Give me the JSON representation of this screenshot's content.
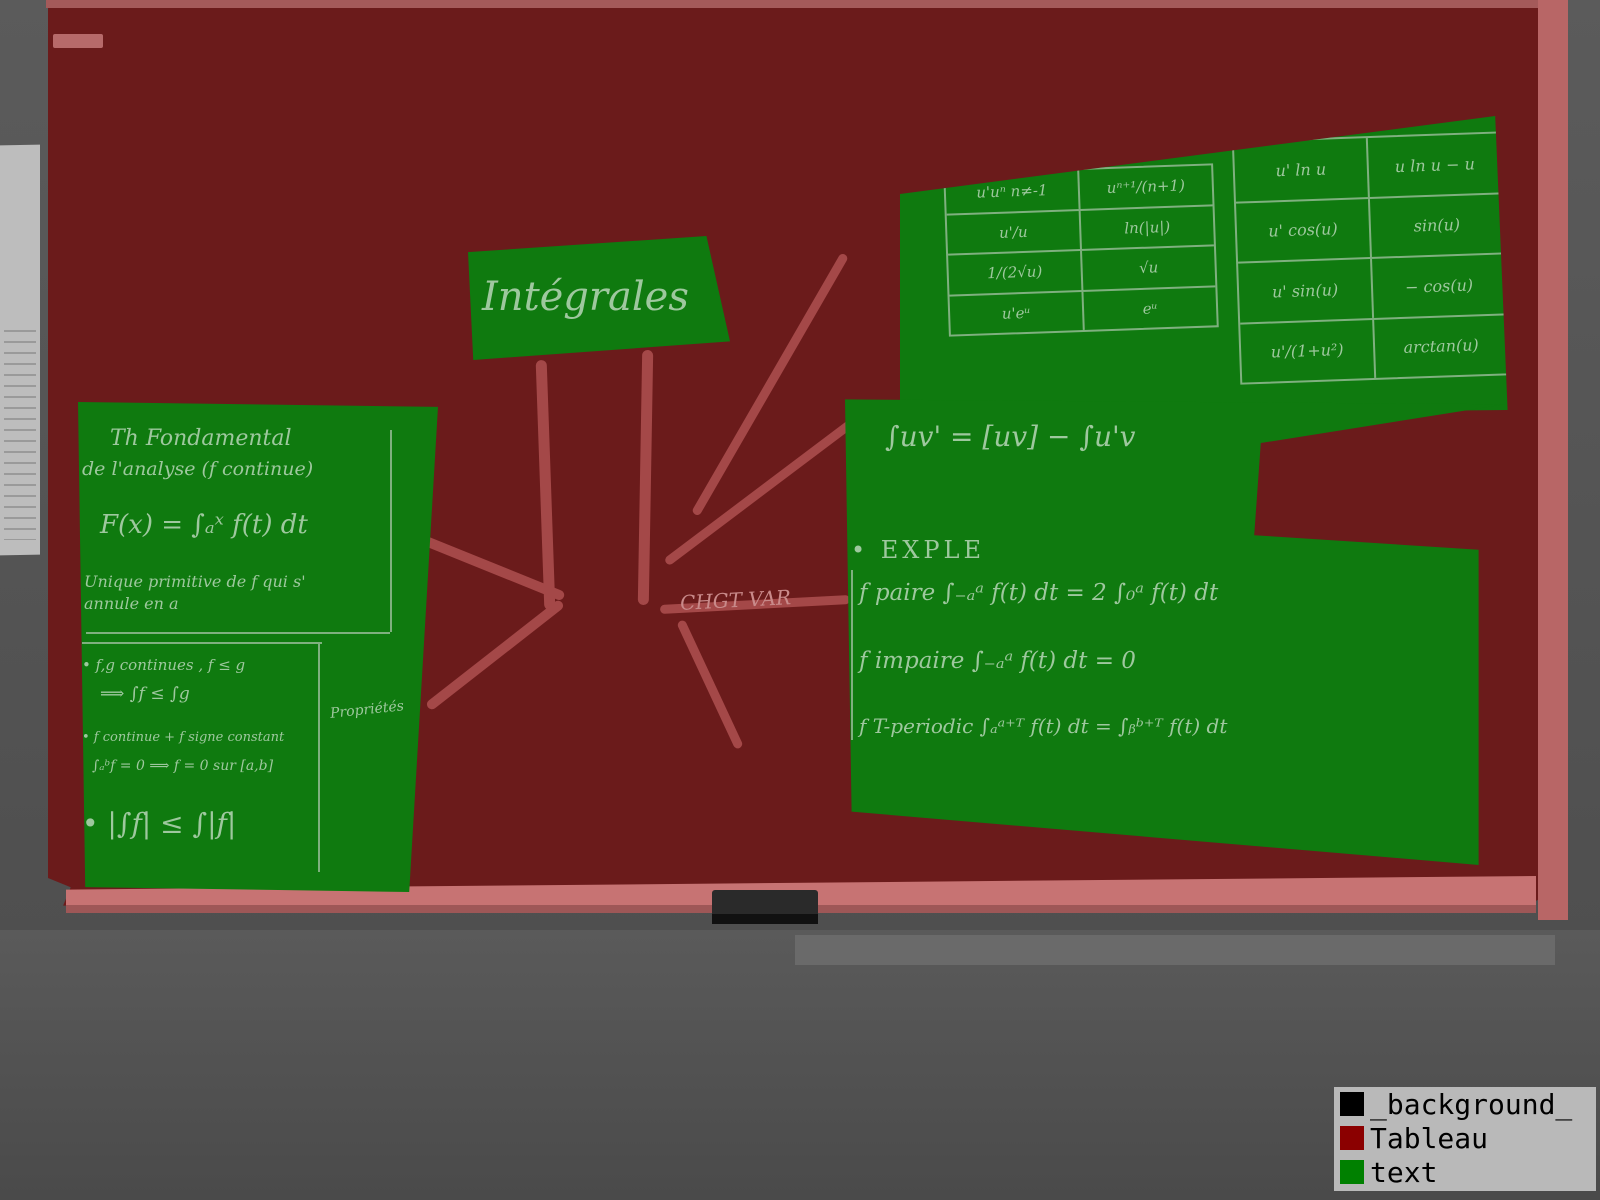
{
  "legend": {
    "items": [
      {
        "label": "_background_",
        "color": "#000000"
      },
      {
        "label": "Tableau",
        "color": "#8b0000"
      },
      {
        "label": "text",
        "color": "#008000"
      }
    ]
  },
  "board": {
    "title": "Intégrales",
    "left": {
      "heading1": "Th Fondamental",
      "heading2": "de l'analyse (f continue)",
      "formula": "F(x) = ∫ₐˣ f(t) dt",
      "note1": "Unique primitive de f qui s'",
      "note2": "annule en a",
      "prop1": "• f,g continues , f ≤ g",
      "prop2": "⟹ ∫f ≤ ∫g",
      "prop3": "• f continue + f signe constant",
      "prop4": "∫ₐᵇf = 0 ⟹ f = 0 sur [a,b]",
      "prop5": "• |∫f| ≤ ∫|f|",
      "side_label": "Propriétés"
    },
    "table_left": [
      [
        "u'uⁿ n≠-1",
        "uⁿ⁺¹/(n+1)"
      ],
      [
        "u'/u",
        "ln(|u|)"
      ],
      [
        "1/(2√u)",
        "√u"
      ],
      [
        "u'eᵘ",
        "eᵘ"
      ]
    ],
    "table_right": [
      [
        "u' ln u",
        "u ln u − u"
      ],
      [
        "u' cos(u)",
        "sin(u)"
      ],
      [
        "u' sin(u)",
        "− cos(u)"
      ],
      [
        "u'/(1+u²)",
        "arctan(u)"
      ]
    ],
    "ipp": "∫uv' = [uv] − ∫u'v",
    "exple": "• EXPLE",
    "parity": [
      "f paire   ∫₋ₐᵃ f(t) dt = 2 ∫₀ᵃ f(t) dt",
      "f impaire   ∫₋ₐᵃ f(t) dt = 0",
      "f T-periodic   ∫ₐᵃ⁺ᵀ f(t) dt = ∫ᵦᵇ⁺ᵀ f(t) dt"
    ],
    "branch_label": "CHGT VAR"
  }
}
